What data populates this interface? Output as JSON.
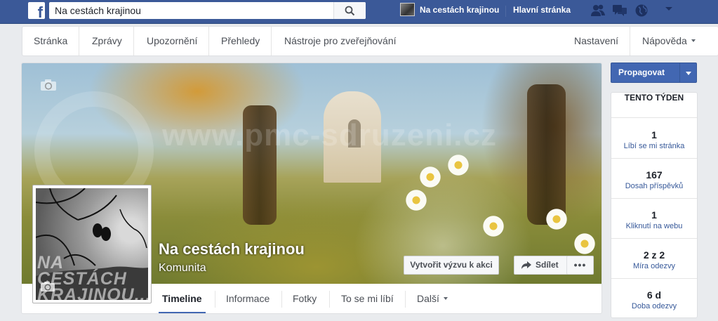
{
  "search": {
    "value": "Na cestách krajinou",
    "icon": "search-icon"
  },
  "bluebar": {
    "logo_letter": "f",
    "page_link": "Na cestách krajinou",
    "home_link": "Hlavní stránka",
    "icons": [
      "friends-icon",
      "messages-icon",
      "globe-icon",
      "caret-down-icon"
    ]
  },
  "admin_nav": {
    "items": [
      "Stránka",
      "Zprávy",
      "Upozornění",
      "Přehledy",
      "Nástroje pro zveřejňování"
    ],
    "settings": "Nastavení",
    "help": "Nápověda"
  },
  "cover": {
    "watermark": "www.pmc-sdruzeni.cz",
    "profile_text": [
      "NA",
      "CESTÁCH",
      "KRAJINOU..."
    ],
    "page_name": "Na cestách krajinou",
    "category": "Komunita"
  },
  "actions": {
    "challenge": "Vytvořit výzvu k akci",
    "share": "Sdílet",
    "more": "•••"
  },
  "tabs": {
    "timeline": "Timeline",
    "about": "Informace",
    "photos": "Fotky",
    "likes": "To se mi líbí",
    "more": "Další"
  },
  "promote": {
    "label": "Propagovat"
  },
  "this_week": {
    "title": "TENTO TÝDEN",
    "stats": [
      {
        "value": "1",
        "label": "Líbí se mi stránka"
      },
      {
        "value": "167",
        "label": "Dosah příspěvků"
      },
      {
        "value": "1",
        "label": "Kliknutí na webu"
      },
      {
        "value": "2 z 2",
        "label": "Míra odezvy"
      },
      {
        "value": "6 d",
        "label": "Doba odezvy"
      }
    ]
  },
  "colors": {
    "brand": "#3b5998",
    "accent": "#4267b2",
    "link": "#365899"
  }
}
